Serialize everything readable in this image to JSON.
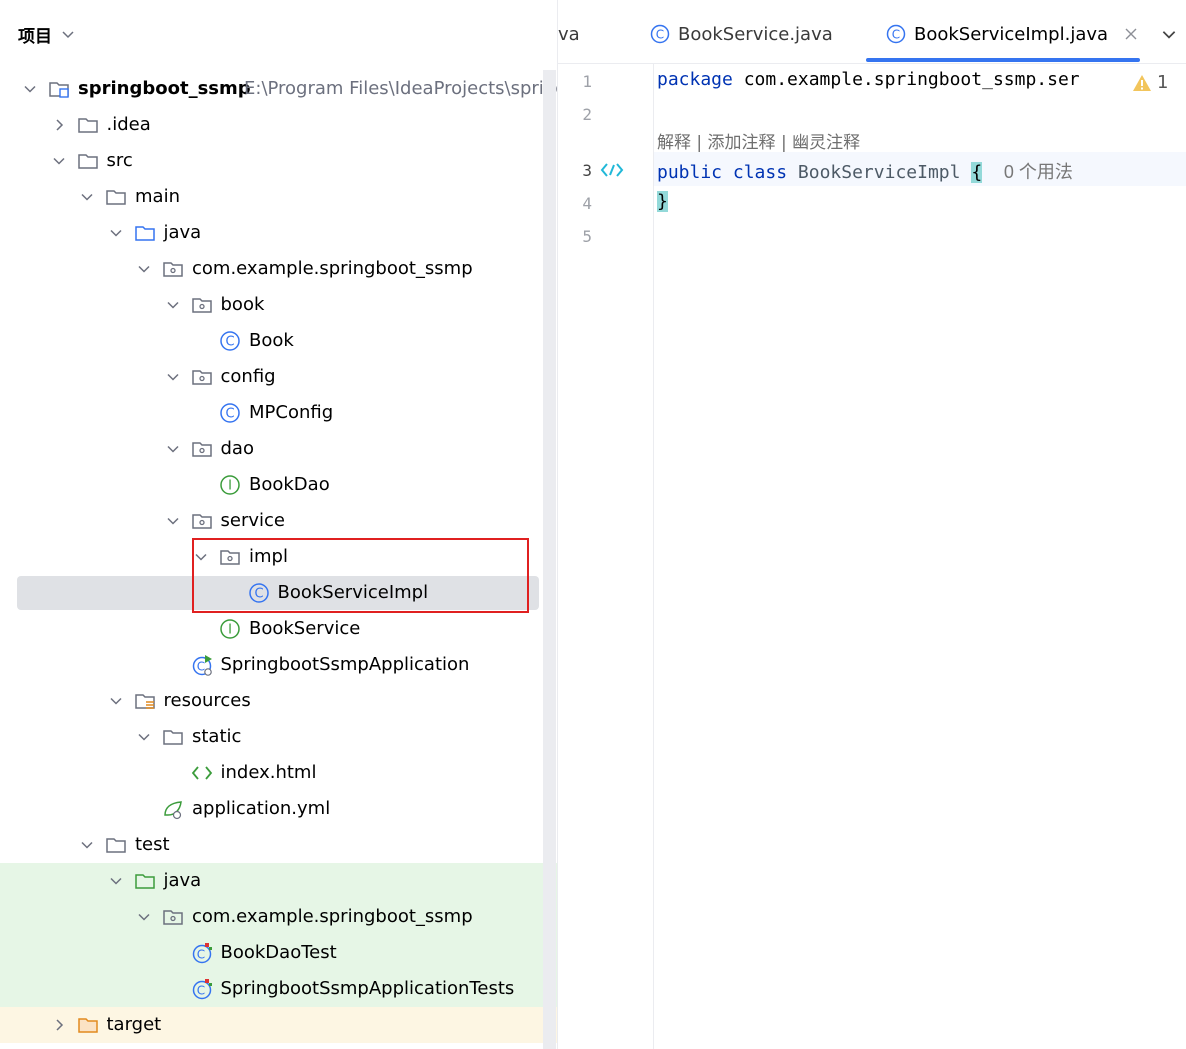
{
  "project_panel": {
    "title": "项目",
    "tree": [
      {
        "label": "springboot_ssmp",
        "path": "E:\\Program Files\\IdeaProjects\\spring",
        "indent": 0,
        "icon": "module-folder-icon",
        "expanded": true
      },
      {
        "label": ".idea",
        "indent": 1,
        "icon": "folder-icon",
        "expanded": false
      },
      {
        "label": "src",
        "indent": 1,
        "icon": "folder-icon",
        "expanded": true
      },
      {
        "label": "main",
        "indent": 2,
        "icon": "folder-icon",
        "expanded": true
      },
      {
        "label": "java",
        "indent": 3,
        "icon": "source-folder-icon",
        "expanded": true
      },
      {
        "label": "com.example.springboot_ssmp",
        "indent": 4,
        "icon": "package-icon",
        "expanded": true
      },
      {
        "label": "book",
        "indent": 5,
        "icon": "package-icon",
        "expanded": true
      },
      {
        "label": "Book",
        "indent": 6,
        "icon": "class-icon"
      },
      {
        "label": "config",
        "indent": 5,
        "icon": "package-icon",
        "expanded": true
      },
      {
        "label": "MPConfig",
        "indent": 6,
        "icon": "class-icon"
      },
      {
        "label": "dao",
        "indent": 5,
        "icon": "package-icon",
        "expanded": true
      },
      {
        "label": "BookDao",
        "indent": 6,
        "icon": "interface-icon"
      },
      {
        "label": "service",
        "indent": 5,
        "icon": "package-icon",
        "expanded": true
      },
      {
        "label": "impl",
        "indent": 6,
        "icon": "package-icon",
        "expanded": true
      },
      {
        "label": "BookServiceImpl",
        "indent": 7,
        "icon": "class-icon",
        "selected": true
      },
      {
        "label": "BookService",
        "indent": 6,
        "icon": "interface-icon"
      },
      {
        "label": "SpringbootSsmpApplication",
        "indent": 5,
        "icon": "spring-boot-class-icon"
      },
      {
        "label": "resources",
        "indent": 3,
        "icon": "resources-folder-icon",
        "expanded": true
      },
      {
        "label": "static",
        "indent": 4,
        "icon": "folder-icon",
        "expanded": true
      },
      {
        "label": "index.html",
        "indent": 5,
        "icon": "html-file-icon"
      },
      {
        "label": "application.yml",
        "indent": 4,
        "icon": "yaml-config-icon"
      },
      {
        "label": "test",
        "indent": 2,
        "icon": "folder-icon",
        "expanded": true
      },
      {
        "label": "java",
        "indent": 3,
        "icon": "test-source-folder-icon",
        "expanded": true,
        "test": true
      },
      {
        "label": "com.example.springboot_ssmp",
        "indent": 4,
        "icon": "package-icon",
        "expanded": true,
        "test": true
      },
      {
        "label": "BookDaoTest",
        "indent": 5,
        "icon": "test-class-icon",
        "test": true
      },
      {
        "label": "SpringbootSsmpApplicationTests",
        "indent": 5,
        "icon": "test-class-icon",
        "test": true
      },
      {
        "label": "target",
        "indent": 1,
        "icon": "excluded-folder-icon",
        "expanded": false,
        "excluded": true
      }
    ]
  },
  "editor": {
    "tabs": [
      {
        "label": "va",
        "partial": true
      },
      {
        "label": "BookService.java"
      },
      {
        "label": "BookServiceImpl.java",
        "active": true
      }
    ],
    "line_numbers": [
      "1",
      "2",
      "3",
      "4",
      "5"
    ],
    "code": {
      "line1_kw": "package",
      "line1_rest": " com.example.springboot_ssmp.ser",
      "hint_links": "解释 | 添加注释 | 幽灵注释",
      "line3_kw1": "public",
      "line3_kw2": "class",
      "line3_cls": "BookServiceImpl",
      "line3_brace": "{",
      "line3_usages": "0 个用法",
      "line4_brace": "}"
    },
    "warnings_count": "1",
    "colors": {
      "keyword": "#0033b3",
      "accent": "#3574f0",
      "selection": "#dfe1e5",
      "highlight_box": "#e02020"
    }
  }
}
